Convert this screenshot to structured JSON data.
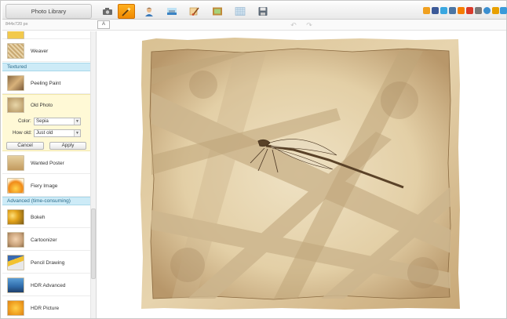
{
  "toolbar": {
    "library_label": "Photo Library",
    "tools": [
      {
        "icon": "camera-icon",
        "active": false
      },
      {
        "icon": "magic-wand-icon",
        "active": true
      },
      {
        "icon": "portrait-icon",
        "active": false
      },
      {
        "icon": "landscape-icon",
        "active": false
      },
      {
        "icon": "brush-icon",
        "active": false
      },
      {
        "icon": "frame-icon",
        "active": false
      },
      {
        "icon": "texture-icon",
        "active": false
      },
      {
        "icon": "save-icon",
        "active": false
      }
    ],
    "social_icons": [
      {
        "icon": "home-icon",
        "color": "#f0a020"
      },
      {
        "icon": "facebook-icon",
        "color": "#3b5998"
      },
      {
        "icon": "twitter-icon",
        "color": "#3aa7e0"
      },
      {
        "icon": "vk-icon",
        "color": "#4c75a3"
      },
      {
        "icon": "blogger-icon",
        "color": "#f57d00"
      },
      {
        "icon": "delicious-icon",
        "color": "#d93a2b"
      },
      {
        "icon": "myspace-icon",
        "color": "#7a7a7a"
      },
      {
        "icon": "settings-icon",
        "color": "#3b8fd0"
      },
      {
        "icon": "mail-icon",
        "color": "#e8a000"
      },
      {
        "icon": "fullscreen-icon",
        "color": "#3a9ad9"
      }
    ]
  },
  "subbar": {
    "dimensions": "844x720 px",
    "compare_label": "A"
  },
  "sidebar": {
    "items_top": [
      {
        "label": "Weaver",
        "icon": "weaver-thumb-icon"
      }
    ],
    "category_textured": "Textured",
    "items_textured": [
      {
        "label": "Peeling Paint",
        "icon": "peeling-paint-thumb-icon"
      }
    ],
    "expanded": {
      "label": "Old Photo",
      "icon": "old-photo-thumb-icon",
      "color_label": "Color:",
      "color_value": "Sepia",
      "how_old_label": "How old:",
      "how_old_value": "Just old",
      "cancel_label": "Cancel",
      "apply_label": "Apply"
    },
    "items_textured_more": [
      {
        "label": "Wanted Poster",
        "icon": "wanted-poster-thumb-icon"
      },
      {
        "label": "Fiery Image",
        "icon": "fiery-image-thumb-icon"
      }
    ],
    "category_advanced": "Advanced (time-consuming)",
    "items_advanced": [
      {
        "label": "Bokeh",
        "icon": "bokeh-thumb-icon"
      },
      {
        "label": "Cartoonizer",
        "icon": "cartoonizer-thumb-icon"
      },
      {
        "label": "Pencil Drawing",
        "icon": "pencil-drawing-thumb-icon"
      },
      {
        "label": "HDR Advanced",
        "icon": "hdr-advanced-thumb-icon"
      },
      {
        "label": "HDR Picture",
        "icon": "hdr-picture-thumb-icon"
      }
    ]
  },
  "canvas": {
    "image_icon": "dragonfly-sepia-photo"
  }
}
